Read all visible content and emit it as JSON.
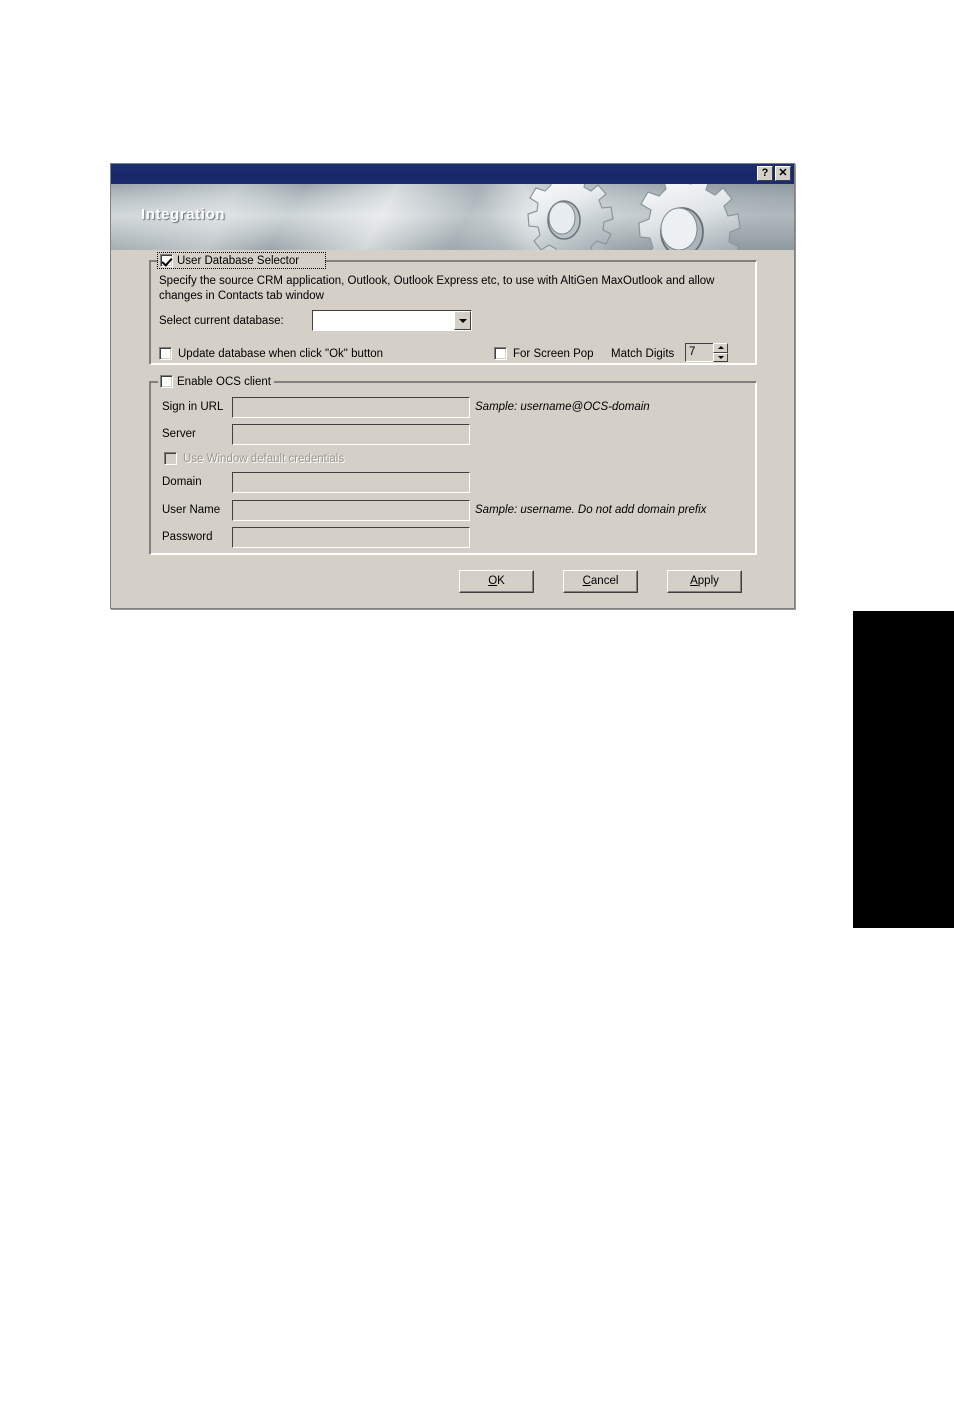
{
  "window": {
    "title_bar": {
      "help_button": "?",
      "close_button": "✕"
    },
    "banner_title": "Integration"
  },
  "user_database_group": {
    "legend": "User Database Selector",
    "checked": true,
    "description": "Specify the source CRM application, Outlook, Outlook Express etc, to use with AltiGen MaxOutlook and allow changes in Contacts tab window",
    "select_label": "Select current database:",
    "select_value": "",
    "update_db_label": "Update database when click \"Ok\" button",
    "update_db_checked": false,
    "screen_pop_label": "For Screen Pop",
    "screen_pop_checked": false,
    "match_digits_label": "Match Digits",
    "match_digits_value": "7"
  },
  "ocs_group": {
    "legend": "Enable OCS client",
    "checked": false,
    "fields": [
      {
        "label": "Sign in URL",
        "value": "",
        "sample": "Sample: username@OCS-domain"
      },
      {
        "label": "Server",
        "value": "",
        "sample": ""
      },
      {
        "label": "Domain",
        "value": "",
        "sample": ""
      },
      {
        "label": "User Name",
        "value": "",
        "sample": "Sample: username. Do not add domain prefix"
      },
      {
        "label": "Password",
        "value": "",
        "sample": ""
      }
    ],
    "use_window_credentials_label": "Use Window default credentials",
    "use_window_credentials_checked": false,
    "use_window_credentials_disabled": true
  },
  "buttons": {
    "ok": {
      "prefix": "",
      "accel": "O",
      "suffix": "K"
    },
    "cancel": {
      "prefix": "",
      "accel": "C",
      "suffix": "ancel"
    },
    "apply": {
      "prefix": "",
      "accel": "A",
      "suffix": "pply"
    }
  },
  "colors": {
    "titlebar": "#1a2d6d",
    "dialog_face": "#d4d0c8",
    "banner_light": "#cfd6d8",
    "banner_dark": "#9aa5ab",
    "disabled_text": "#9a968e"
  }
}
